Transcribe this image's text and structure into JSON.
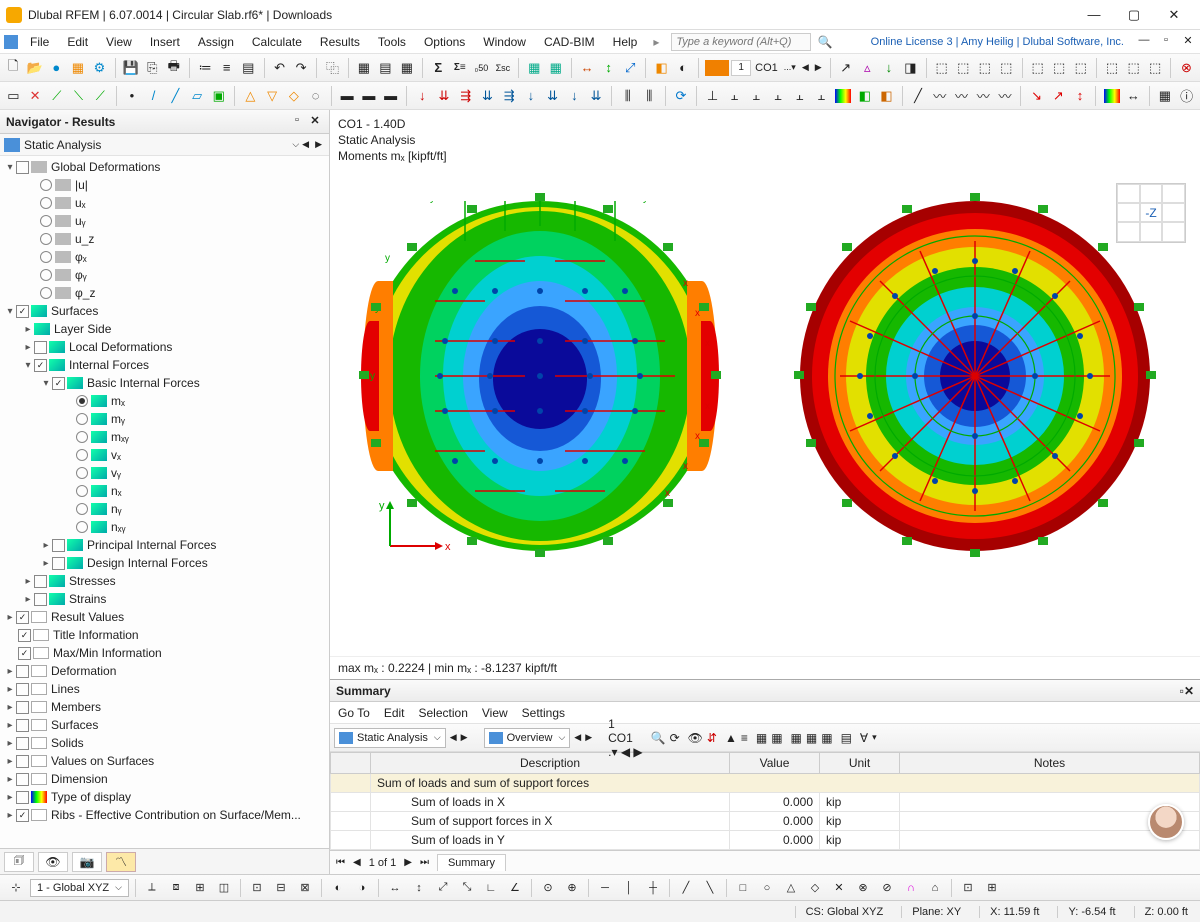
{
  "title": "Dlubal RFEM | 6.07.0014 | Circular Slab.rf6* | Downloads",
  "menus": [
    "File",
    "Edit",
    "View",
    "Insert",
    "Assign",
    "Calculate",
    "Results",
    "Tools",
    "Options",
    "Window",
    "CAD-BIM",
    "Help"
  ],
  "keyword_placeholder": "Type a keyword (Alt+Q)",
  "license": "Online License 3 | Amy Heilig | Dlubal Software, Inc.",
  "navigator": {
    "title": "Navigator - Results",
    "analysis": "Static Analysis",
    "tree": {
      "global_def": "Global Deformations",
      "components": [
        "|u|",
        "uₓ",
        "uᵧ",
        "u_z",
        "φₓ",
        "φᵧ",
        "φ_z"
      ],
      "surfaces": "Surfaces",
      "layer_side": "Layer Side",
      "local_def": "Local Deformations",
      "internal_forces": "Internal Forces",
      "basic_if": "Basic Internal Forces",
      "bif_items": [
        "mₓ",
        "mᵧ",
        "mₓᵧ",
        "vₓ",
        "vᵧ",
        "nₓ",
        "nᵧ",
        "nₓᵧ"
      ],
      "principal_if": "Principal Internal Forces",
      "design_if": "Design Internal Forces",
      "stresses": "Stresses",
      "strains": "Strains",
      "result_values": "Result Values",
      "title_info": "Title Information",
      "maxmin_info": "Max/Min Information",
      "deformation": "Deformation",
      "lines": "Lines",
      "members": "Members",
      "surfaces2": "Surfaces",
      "solids": "Solids",
      "values_on_surfaces": "Values on Surfaces",
      "dimension": "Dimension",
      "type_display": "Type of display",
      "ribs": "Ribs - Effective Contribution on Surface/Mem..."
    }
  },
  "viewport": {
    "line1": "CO1 - 1.40D",
    "line2": "Static Analysis",
    "line3": "Moments mₓ [kipft/ft]",
    "cube": "-Z",
    "stats": "max mₓ : 0.2224 | min mₓ : -8.1237 kipft/ft"
  },
  "summary": {
    "title": "Summary",
    "menus": [
      "Go To",
      "Edit",
      "Selection",
      "View",
      "Settings"
    ],
    "sel1": "Static Analysis",
    "sel2": "Overview",
    "co_num": "1",
    "co_label": "CO1",
    "columns": [
      "Description",
      "Value",
      "Unit",
      "Notes"
    ],
    "section": "Sum of loads and sum of support forces",
    "rows": [
      {
        "d": "Sum of loads in X",
        "v": "0.000",
        "u": "kip"
      },
      {
        "d": "Sum of support forces in X",
        "v": "0.000",
        "u": "kip"
      },
      {
        "d": "Sum of loads in Y",
        "v": "0.000",
        "u": "kip"
      }
    ],
    "page": "1 of 1",
    "tab": "Summary"
  },
  "coordbar": {
    "cs": "1 - Global XYZ"
  },
  "status": {
    "cs": "CS: Global XYZ",
    "plane": "Plane: XY",
    "x": "X: 11.59 ft",
    "y": "Y: -6.54 ft",
    "z": "Z: 0.00 ft"
  }
}
